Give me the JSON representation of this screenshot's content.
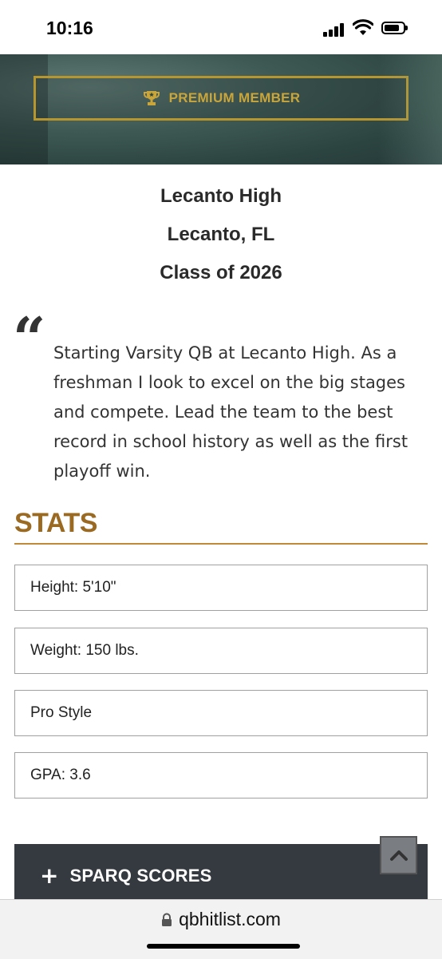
{
  "status_bar": {
    "time": "10:16"
  },
  "hero": {
    "premium_label": "PREMIUM MEMBER",
    "premium_icon": "trophy-icon",
    "accent_color": "#c9a53a"
  },
  "school": {
    "name": "Lecanto High",
    "location": "Lecanto, FL",
    "class_year": "Class of 2026"
  },
  "bio": {
    "quote_mark": "“",
    "text": "Starting Varsity QB at Lecanto High. As a freshman I look to excel on the big stages and compete. Lead the team to the best record in school history as well as the first playoff win."
  },
  "stats": {
    "title": "STATS",
    "title_color": "#9a6a22",
    "items": [
      {
        "text": "Height: 5'10\""
      },
      {
        "text": "Weight: 150 lbs."
      },
      {
        "text": "Pro Style"
      },
      {
        "text": "GPA: 3.6"
      }
    ]
  },
  "sparq": {
    "expand_symbol": "+",
    "label": "SPARQ SCORES"
  },
  "browser": {
    "url": "qbhitlist.com",
    "lock_icon": "lock-icon"
  }
}
